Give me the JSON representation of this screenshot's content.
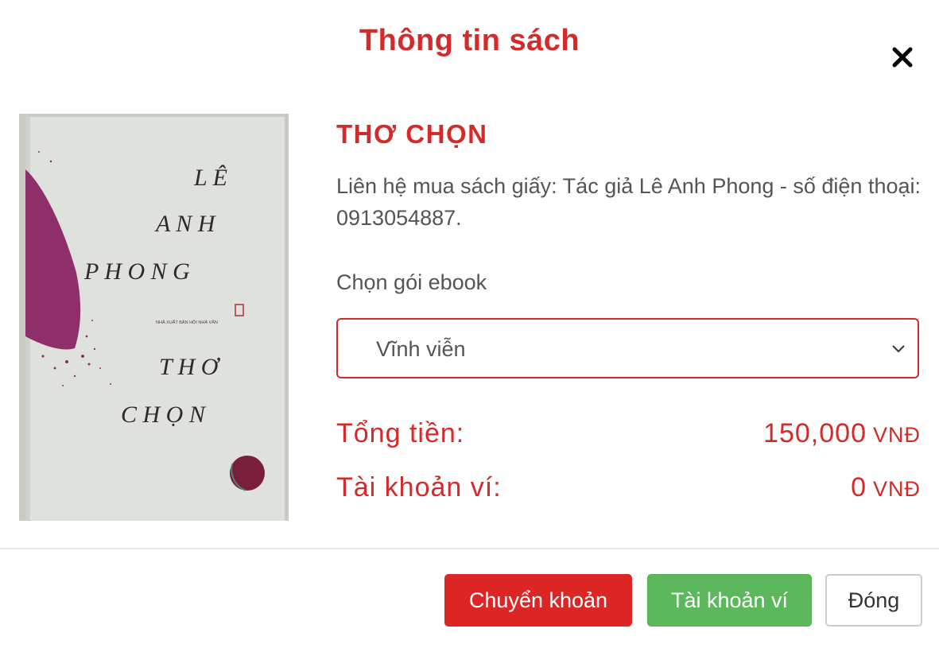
{
  "modal": {
    "title": "Thông tin sách",
    "close_icon": "close-icon"
  },
  "cover": {
    "author_lines": [
      "L Ê",
      "A N H",
      "P H O N G"
    ],
    "publisher": "NHÀ XUẤT BẢN HỘI NHÀ VĂN",
    "title_lines": [
      "T H Ơ",
      "C H Ọ N"
    ],
    "colors": {
      "background": "#dfe1dc",
      "splash": "#8e2f6c",
      "dot": "#7a1f3a"
    }
  },
  "book": {
    "title": "THƠ CHỌN",
    "description": "Liên hệ mua sách giấy: Tác giả Lê Anh Phong - số điện thoại: 0913054887."
  },
  "package": {
    "label": "Chọn gói ebook",
    "selected": "Vĩnh viễn",
    "chevron_icon": "chevron-down-icon"
  },
  "total": {
    "label": "Tổng tiền:",
    "amount": "150,000",
    "currency": "VNĐ"
  },
  "wallet": {
    "label": "Tài khoản ví:",
    "amount": "0",
    "currency": "VNĐ"
  },
  "buttons": {
    "transfer": "Chuyển khoản",
    "wallet": "Tài khoản ví",
    "close": "Đóng"
  },
  "colors": {
    "accent": "#d32a2a",
    "transfer_button": "#dc2626",
    "wallet_button": "#5cb85c"
  }
}
